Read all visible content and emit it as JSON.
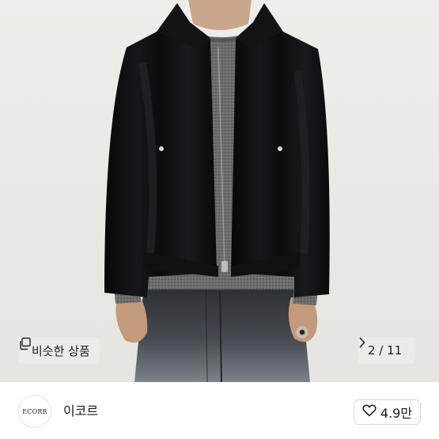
{
  "product_image": {
    "similar_items_label": "비슷한 상품",
    "similar_items_icon": "copy-squares-icon",
    "page_counter": "2 / 11",
    "next_icon": "chevron-right-icon"
  },
  "seller": {
    "avatar_logo_text": "ECORR",
    "name": "이코르"
  },
  "like": {
    "icon": "heart-outline-icon",
    "count": "4.9만"
  },
  "colors": {
    "background": "#ffffff",
    "chip_background": "#ececec",
    "text": "#1a1a1a",
    "jacket": "#0c0c0e",
    "sweater": "#6a6a6a",
    "jeans": "#3b3f44"
  }
}
